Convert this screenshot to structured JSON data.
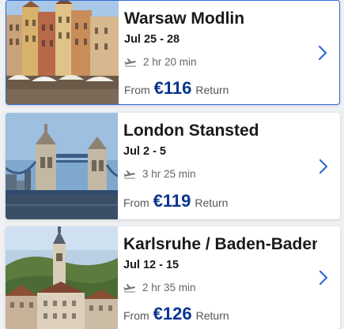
{
  "flights": [
    {
      "city": "Warsaw Modlin",
      "dates": "Jul 25 - 28",
      "duration": "2 hr 20 min",
      "from_label": "From",
      "price": "€116",
      "trip_type": "Return",
      "image": "warsaw-old-town",
      "selected": true
    },
    {
      "city": "London Stansted",
      "dates": "Jul 2 - 5",
      "duration": "3 hr 25 min",
      "from_label": "From",
      "price": "€119",
      "trip_type": "Return",
      "image": "tower-bridge",
      "selected": false
    },
    {
      "city": "Karlsruhe / Baden-Baden",
      "dates": "Jul 12 - 15",
      "duration": "2 hr 35 min",
      "from_label": "From",
      "price": "€126",
      "trip_type": "Return",
      "image": "baden-baden-town",
      "selected": false
    }
  ],
  "icons": {
    "duration": "plane-icon",
    "open": "chevron-right-icon"
  },
  "colors": {
    "price": "#073590",
    "chevron": "#2d6bd4",
    "selected_border": "#2d6bd4"
  }
}
